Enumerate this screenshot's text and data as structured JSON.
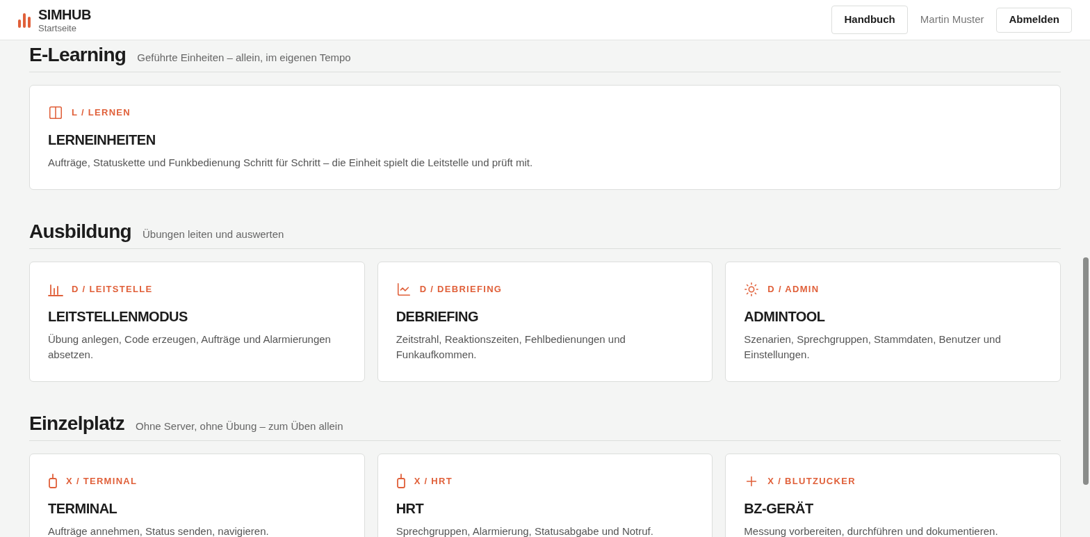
{
  "header": {
    "title": "SIMHUB",
    "subtitle": "Startseite",
    "manual_button": "Handbuch",
    "user": "Martin Muster",
    "logout_button": "Abmelden"
  },
  "sections": [
    {
      "title": "E-Learning",
      "subtitle": "Geführte Einheiten – allein, im eigenen Tempo",
      "cards": [
        {
          "label": "L / LERNEN",
          "title": "LERNEINHEITEN",
          "description": "Aufträge, Statuskette und Funkbedienung Schritt für Schritt – die Einheit spielt die Leitstelle und prüft mit."
        }
      ]
    },
    {
      "title": "Ausbildung",
      "subtitle": "Übungen leiten und auswerten",
      "cards": [
        {
          "label": "D / LEITSTELLE",
          "title": "LEITSTELLENMODUS",
          "description": "Übung anlegen, Code erzeugen, Aufträge und Alarmierungen absetzen."
        },
        {
          "label": "D / DEBRIEFING",
          "title": "DEBRIEFING",
          "description": "Zeitstrahl, Reaktionszeiten, Fehlbedienungen und Funkaufkommen."
        },
        {
          "label": "D / ADMIN",
          "title": "ADMINTOOL",
          "description": "Szenarien, Sprechgruppen, Stammdaten, Benutzer und Einstellungen."
        }
      ]
    },
    {
      "title": "Einzelplatz",
      "subtitle": "Ohne Server, ohne Übung – zum Üben allein",
      "cards": [
        {
          "label": "X / TERMINAL",
          "title": "TERMINAL",
          "description": "Aufträge annehmen, Status senden, navigieren."
        },
        {
          "label": "X / HRT",
          "title": "HRT",
          "description": "Sprechgruppen, Alarmierung, Statusabgabe und Notruf."
        },
        {
          "label": "X / BLUTZUCKER",
          "title": "BZ-GERÄT",
          "description": "Messung vorbereiten, durchführen und dokumentieren."
        }
      ]
    }
  ]
}
